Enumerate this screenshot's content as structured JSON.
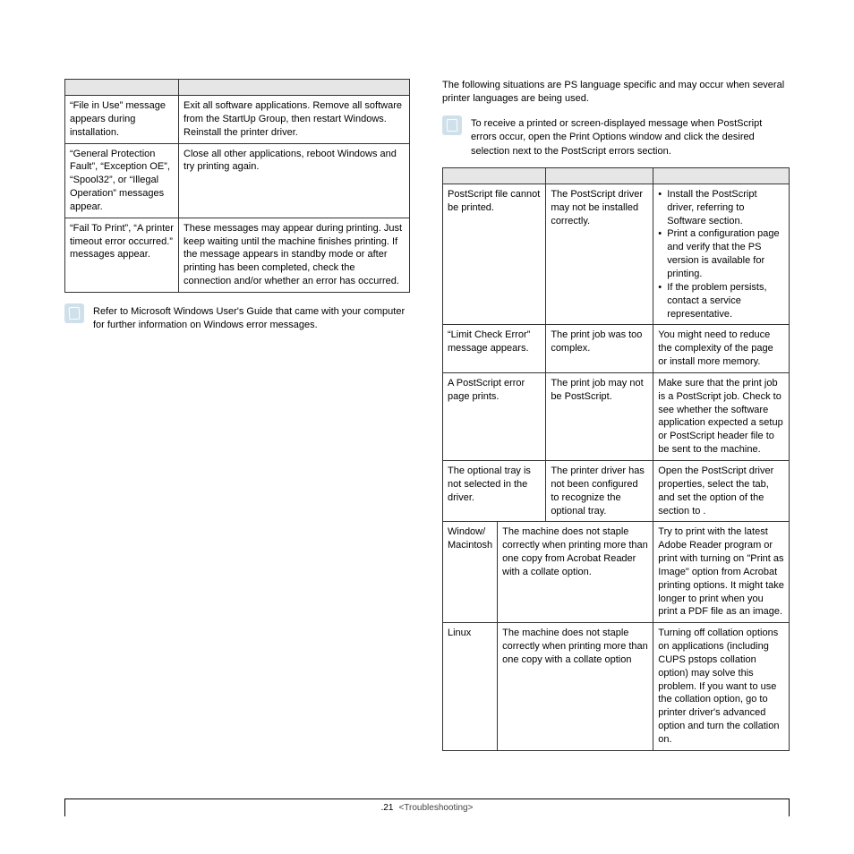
{
  "left_table": {
    "rows": [
      {
        "condition": "“File in Use” message appears during installation.",
        "solution": "Exit all software applications. Remove all software from the StartUp Group, then restart Windows. Reinstall the printer driver."
      },
      {
        "condition": "“General Protection Fault”, “Exception OE”, “Spool32”, or “Illegal Operation” messages appear.",
        "solution": "Close all other applications, reboot Windows and try printing again."
      },
      {
        "condition": "“Fail To Print”, “A printer timeout error occurred.” messages appear.",
        "solution": "These messages may appear during printing. Just keep waiting until the machine finishes printing. If the message appears in standby mode or after printing has been completed, check the connection and/or whether an error has occurred."
      }
    ]
  },
  "left_note": "Refer to Microsoft Windows User's Guide that came with your computer for further information on Windows error messages.",
  "right_intro": "The following situations are PS language specific and may occur when several printer languages are being used.",
  "right_note": "To receive a printed or screen-displayed message when PostScript errors occur, open the Print Options window and click the desired selection next to the PostScript errors section.",
  "right_table": {
    "rows": [
      {
        "c1": "PostScript file cannot be printed.",
        "c2": "The PostScript driver may not be installed correctly.",
        "sol_bullets": [
          "Install the PostScript driver, referring to Software section.",
          "Print a configuration page and verify that the PS version is available for printing.",
          "If the problem persists, contact a service representative."
        ]
      },
      {
        "c1": "“Limit Check Error” message appears.",
        "c2": "The print job was too complex.",
        "sol_text": "You might need to reduce the complexity of the page or install more memory."
      },
      {
        "c1": "A PostScript error page prints.",
        "c2": "The print job may not be PostScript.",
        "sol_text": "Make sure that the print job is a PostScript job. Check to see whether the software application expected a setup or PostScript header file to be sent to the machine."
      },
      {
        "c1": "The optional tray is not selected in the driver.",
        "c2": "The printer driver has not been configured to recognize the optional tray.",
        "sol_pre": "Open the PostScript driver properties, select the ",
        "sol_mid1": " tab, and set the ",
        "sol_mid2": " option of the ",
        "sol_mid3": " section to ",
        "sol_end": "."
      },
      {
        "c1": "Window/\nMacintosh",
        "c2": "The machine does not staple correctly when printing more than one copy from Acrobat Reader with a collate option.",
        "sol_text": "Try to print with the latest Adobe Reader program or print with turning on \"Print as Image\" option from Acrobat printing options. It might take longer to print when you print a PDF file as an image."
      },
      {
        "c1": "Linux",
        "c2": "The machine does not staple correctly when printing more than one copy with a collate option",
        "sol_text": "Turning off collation options on applications (including CUPS pstops collation option) may solve this problem. If you want to use the collation option, go to printer driver's advanced option and turn the collation on."
      }
    ]
  },
  "footer": {
    "page": ".21",
    "section": "<Troubleshooting>"
  }
}
